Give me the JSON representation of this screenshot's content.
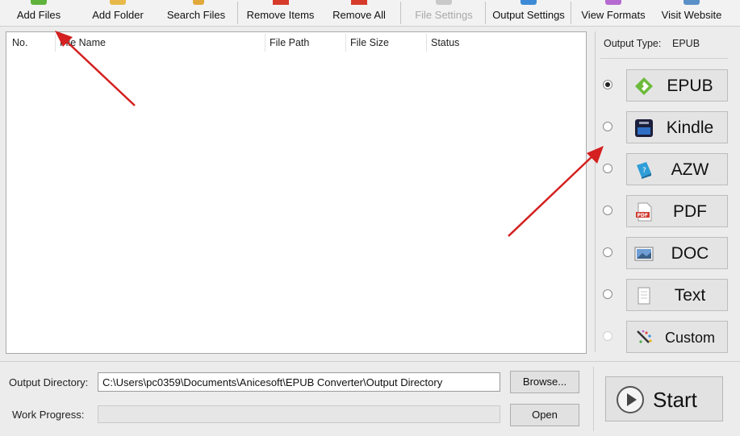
{
  "toolbar": {
    "items": [
      {
        "label": "Add Files",
        "icon": "add-files-icon",
        "enabled": true
      },
      {
        "label": "Add Folder",
        "icon": "add-folder-icon",
        "enabled": true
      },
      {
        "label": "Search Files",
        "icon": "search-files-icon",
        "enabled": true
      },
      {
        "label": "Remove Items",
        "icon": "remove-items-icon",
        "enabled": true
      },
      {
        "label": "Remove All",
        "icon": "remove-all-icon",
        "enabled": true
      },
      {
        "label": "File Settings",
        "icon": "file-settings-icon",
        "enabled": false
      },
      {
        "label": "Output Settings",
        "icon": "output-settings-icon",
        "enabled": true
      },
      {
        "label": "View Formats",
        "icon": "view-formats-icon",
        "enabled": true
      },
      {
        "label": "Visit Website",
        "icon": "visit-website-icon",
        "enabled": true
      }
    ]
  },
  "file_list": {
    "columns": [
      "No.",
      "File Name",
      "File Path",
      "File Size",
      "Status"
    ],
    "rows": []
  },
  "output": {
    "type_label": "Output Type:",
    "type_value": "EPUB",
    "formats": [
      {
        "label": "EPUB",
        "icon": "epub-icon",
        "selected": true,
        "enabled": true
      },
      {
        "label": "Kindle",
        "icon": "kindle-icon",
        "selected": false,
        "enabled": true
      },
      {
        "label": "AZW",
        "icon": "azw-icon",
        "selected": false,
        "enabled": true
      },
      {
        "label": "PDF",
        "icon": "pdf-icon",
        "selected": false,
        "enabled": true
      },
      {
        "label": "DOC",
        "icon": "doc-icon",
        "selected": false,
        "enabled": true
      },
      {
        "label": "Text",
        "icon": "text-icon",
        "selected": false,
        "enabled": true
      },
      {
        "label": "Custom",
        "icon": "custom-icon",
        "selected": false,
        "enabled": false
      }
    ]
  },
  "bottom": {
    "output_directory_label": "Output Directory:",
    "output_directory_value": "C:\\Users\\pc0359\\Documents\\Anicesoft\\EPUB Converter\\Output Directory",
    "browse_label": "Browse...",
    "work_progress_label": "Work Progress:",
    "progress_value": 0,
    "open_label": "Open",
    "start_label": "Start"
  },
  "colors": {
    "annotation_arrow": "#d42020",
    "epub_green": "#6dbb3c",
    "remove_red": "#d63a2a"
  }
}
